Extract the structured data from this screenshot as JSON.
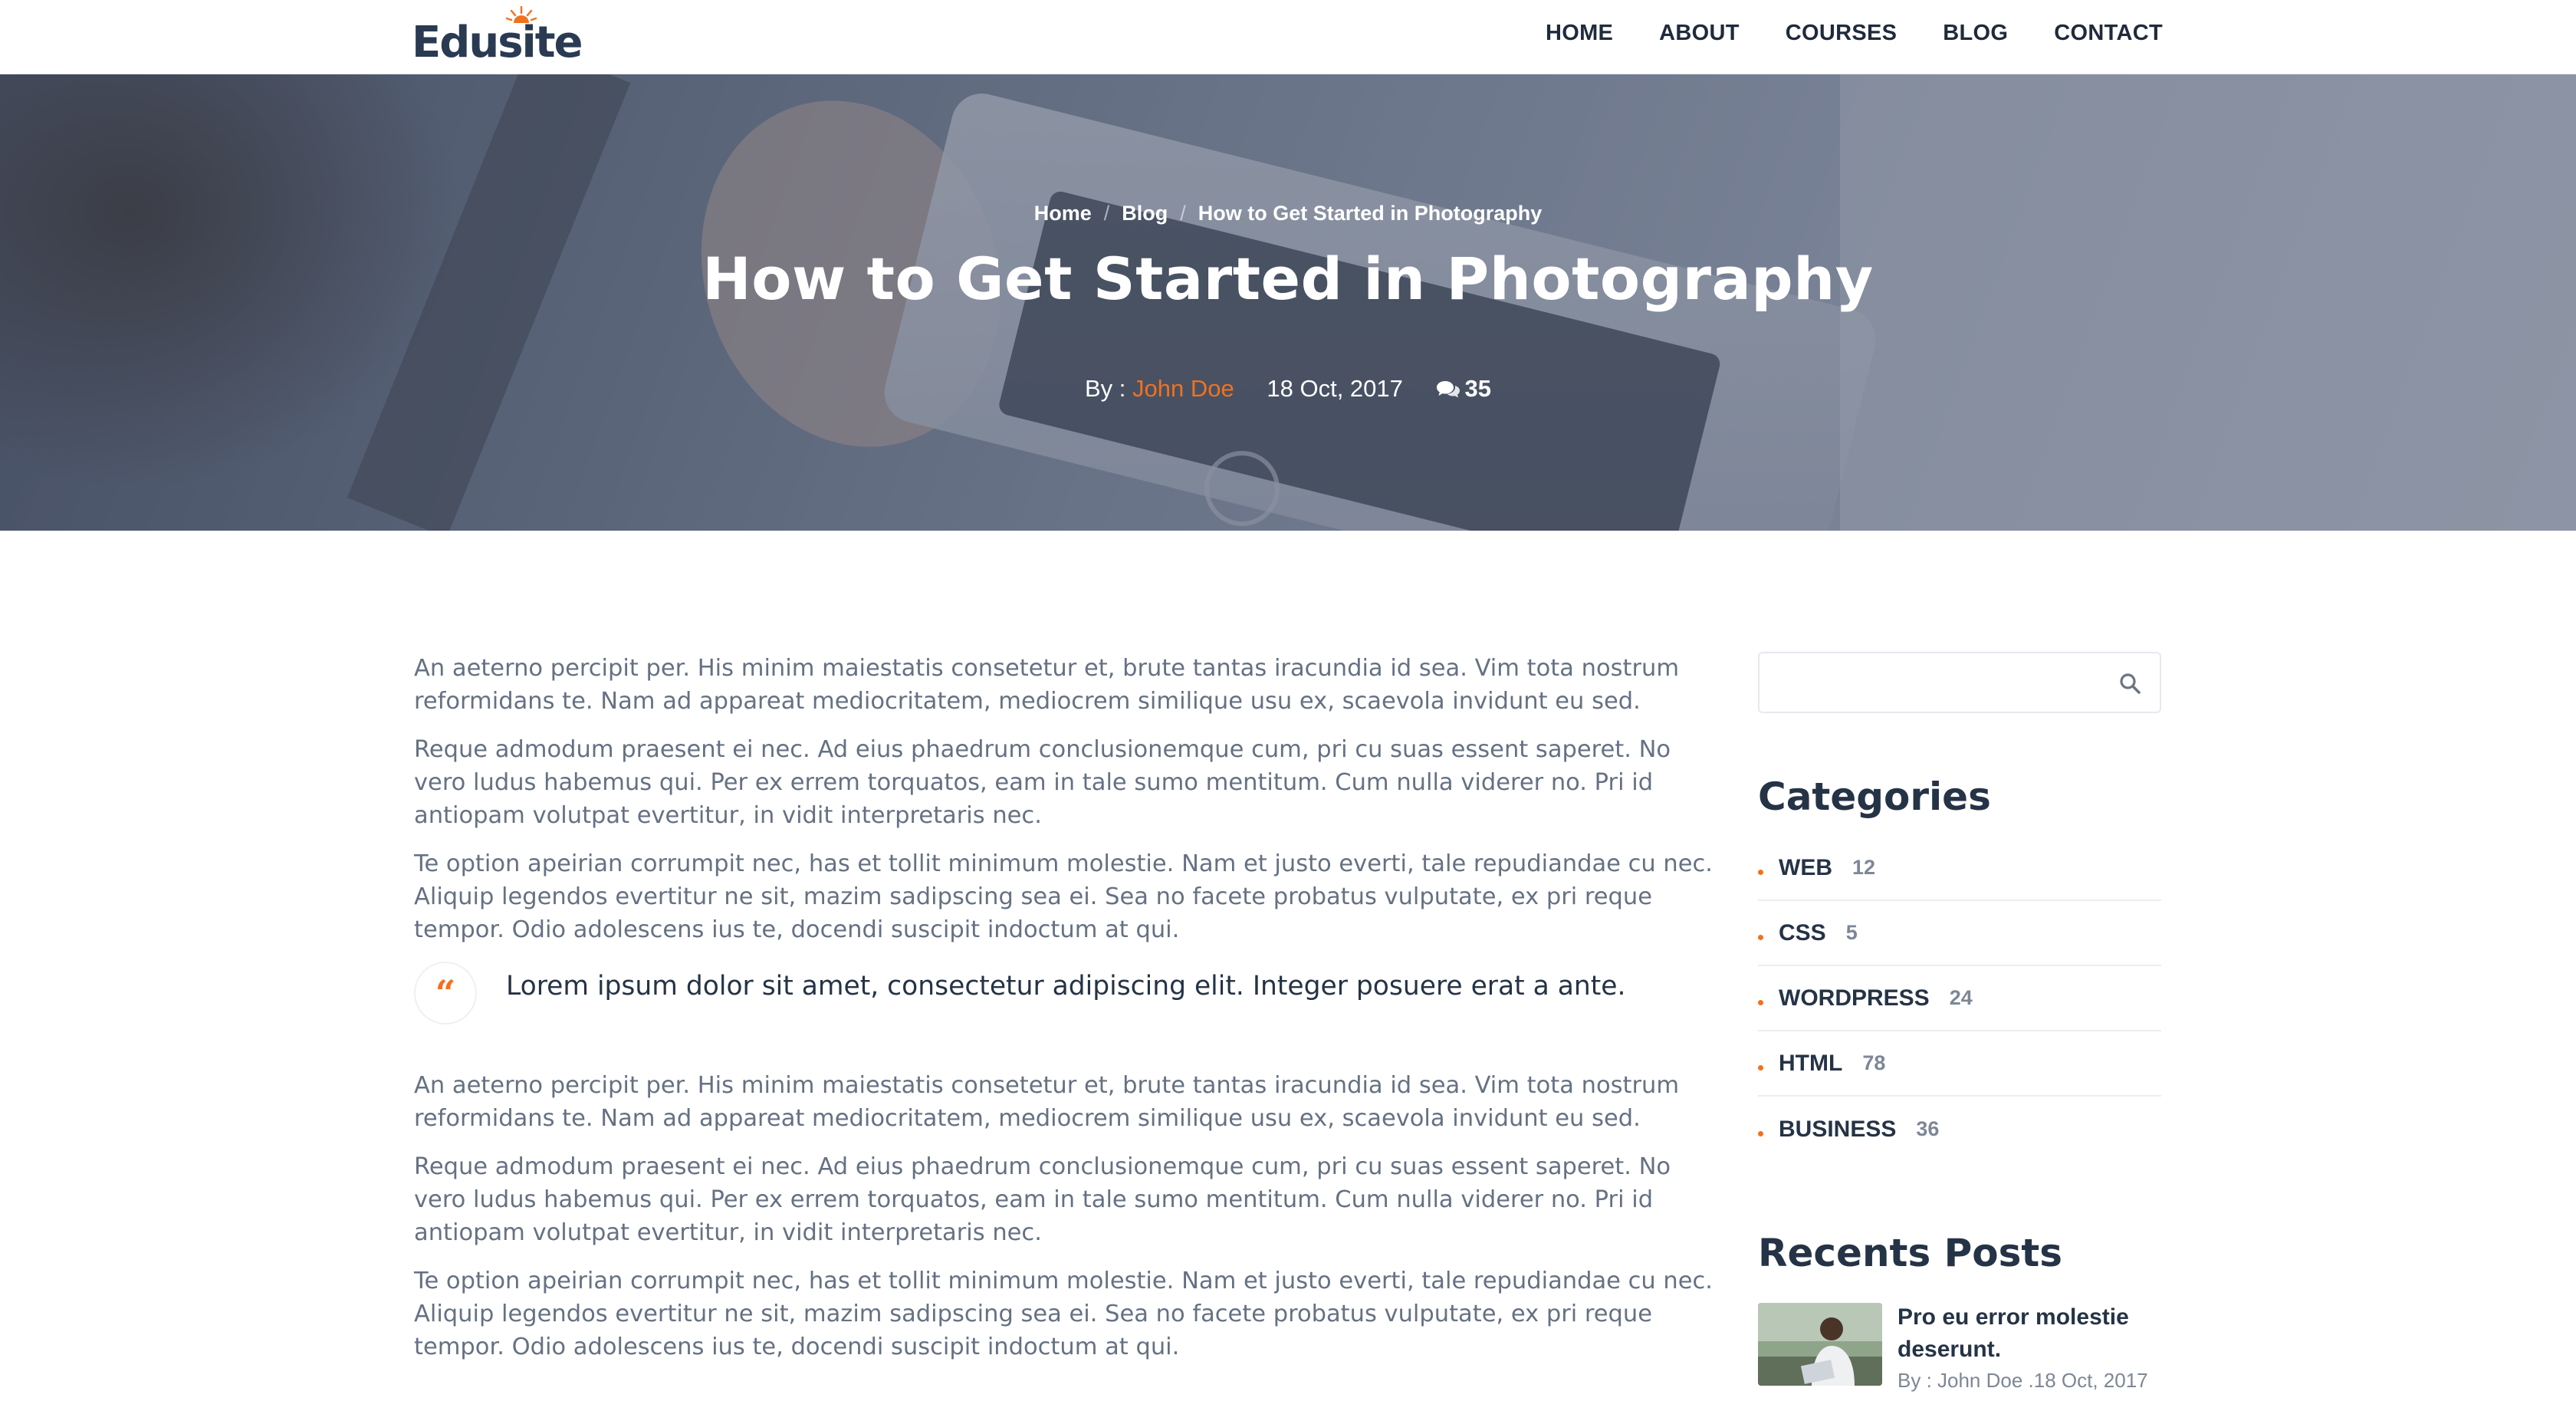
{
  "header": {
    "logo": "Edusite",
    "nav": [
      "HOME",
      "ABOUT",
      "COURSES",
      "BLOG",
      "CONTACT"
    ]
  },
  "hero": {
    "breadcrumb": [
      "Home",
      "Blog",
      "How to Get Started in Photography"
    ],
    "title": "How to Get Started in Photography",
    "by_label": "By :",
    "author": "John Doe",
    "date": "18 Oct, 2017",
    "comments": "35"
  },
  "article": {
    "paragraphs_top": [
      "An aeterno percipit per. His minim maiestatis consetetur et, brute tantas iracundia id sea. Vim tota nostrum reformidans te. Nam ad appareat mediocritatem, mediocrem similique usu ex, scaevola invidunt eu sed.",
      "Reque admodum praesent ei nec. Ad eius phaedrum conclusionemque cum, pri cu suas essent saperet. No vero ludus habemus qui. Per ex errem torquatos, eam in tale sumo mentitum. Cum nulla viderer no. Pri id antiopam volutpat evertitur, in vidit interpretaris nec.",
      "Te option apeirian corrumpit nec, has et tollit minimum molestie. Nam et justo everti, tale repudiandae cu nec. Aliquip legendos evertitur ne sit, mazim sadipscing sea ei. Sea no facete probatus vulputate, ex pri reque tempor. Odio adolescens ius te, docendi suscipit indoctum at qui."
    ],
    "quote": "Lorem ipsum dolor sit amet, consectetur adipiscing elit. Integer posuere erat a ante.",
    "paragraphs_bottom": [
      "An aeterno percipit per. His minim maiestatis consetetur et, brute tantas iracundia id sea. Vim tota nostrum reformidans te. Nam ad appareat mediocritatem, mediocrem similique usu ex, scaevola invidunt eu sed.",
      "Reque admodum praesent ei nec. Ad eius phaedrum conclusionemque cum, pri cu suas essent saperet. No vero ludus habemus qui. Per ex errem torquatos, eam in tale sumo mentitum. Cum nulla viderer no. Pri id antiopam volutpat evertitur, in vidit interpretaris nec.",
      "Te option apeirian corrumpit nec, has et tollit minimum molestie. Nam et justo everti, tale repudiandae cu nec. Aliquip legendos evertitur ne sit, mazim sadipscing sea ei. Sea no facete probatus vulputate, ex pri reque tempor. Odio adolescens ius te, docendi suscipit indoctum at qui."
    ]
  },
  "sidebar": {
    "search_placeholder": "",
    "categories_title": "Categories",
    "categories": [
      {
        "name": "WEB",
        "count": "12"
      },
      {
        "name": "CSS",
        "count": "5"
      },
      {
        "name": "WORDPRESS",
        "count": "24"
      },
      {
        "name": "HTML",
        "count": "78"
      },
      {
        "name": "BUSINESS",
        "count": "36"
      }
    ],
    "recent_title": "Recents Posts",
    "recent_posts": [
      {
        "title": "Pro eu error molestie deserunt.",
        "meta": "By : John Doe .18 Oct, 2017"
      }
    ]
  },
  "colors": {
    "accent": "#f2711c",
    "heading": "#253346",
    "body_text": "#657183",
    "hero_overlay": "#3c465f"
  },
  "icons": {
    "comments": "comments-icon",
    "quote": "quote-icon",
    "search": "search-icon"
  }
}
